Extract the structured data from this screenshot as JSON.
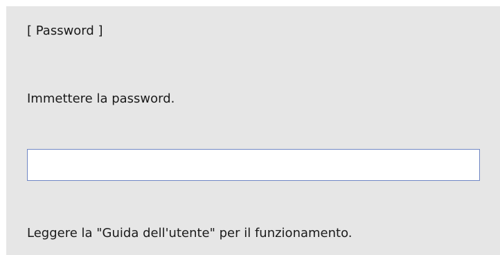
{
  "dialog": {
    "title": "[ Password ]",
    "prompt": "Immettere la password.",
    "password_value": "",
    "help_text": "Leggere la \"Guida dell'utente\" per il funzionamento."
  },
  "colors": {
    "background": "#e6e6e6",
    "input_border": "#6f86c4",
    "input_background": "#ffffff",
    "text": "#1a1a1a"
  }
}
